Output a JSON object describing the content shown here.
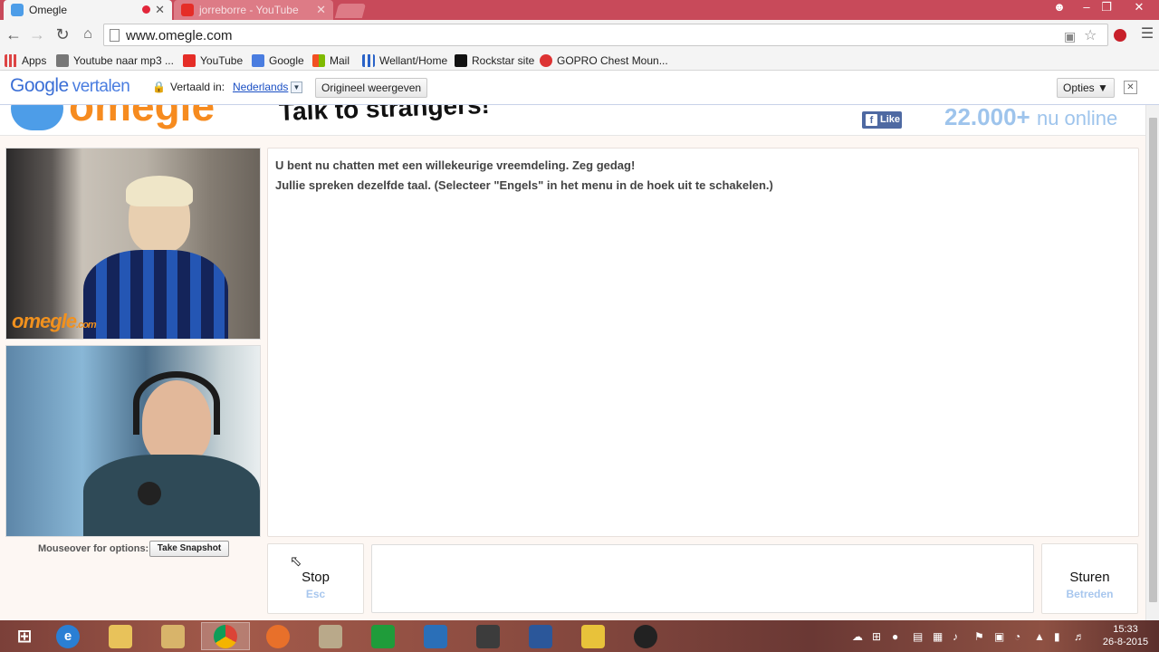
{
  "browser": {
    "tabs": [
      {
        "title": "Omegle",
        "active": true
      },
      {
        "title": "jorreborre - YouTube",
        "active": false
      }
    ],
    "url": "www.omegle.com",
    "bookmarks": [
      {
        "label": "Apps",
        "icon": "apps-grid-icon"
      },
      {
        "label": "Youtube naar mp3 ...",
        "icon": "converter-icon"
      },
      {
        "label": "YouTube",
        "icon": "youtube-icon"
      },
      {
        "label": "Google",
        "icon": "google-icon"
      },
      {
        "label": "Mail",
        "icon": "windows-mail-icon"
      },
      {
        "label": "Wellant/Home",
        "icon": "wellant-icon"
      },
      {
        "label": "Rockstar site",
        "icon": "rockstar-icon"
      },
      {
        "label": "GOPRO Chest Moun...",
        "icon": "gopro-icon"
      }
    ]
  },
  "translate_bar": {
    "logo_google": "Google",
    "logo_product": "vertalen",
    "translated_label": "Vertaald in:",
    "language": "Nederlands",
    "show_original": "Origineel weergeven",
    "options": "Opties ▼",
    "close": "✕"
  },
  "omegle": {
    "logo": "omegle",
    "tagline": "Talk to strangers!",
    "like": "Like",
    "online_count": "22.000+",
    "online_suffix": "nu online",
    "video_watermark": "omegle",
    "video_watermark_suffix": ".com",
    "mouseover_label": "Mouseover for options:",
    "snapshot_button": "Take Snapshot",
    "messages": [
      "U bent nu chatten met een willekeurige vreemdeling. Zeg gedag!",
      "Jullie spreken dezelfde taal. (Selecteer \"Engels\" in het menu in de hoek uit te schakelen.)"
    ],
    "stop_label": "Stop",
    "stop_hint": "Esc",
    "send_label": "Sturen",
    "send_hint": "Betreden",
    "message_input_value": ""
  },
  "taskbar": {
    "clock_time": "15:33",
    "clock_date": "26-8-2015"
  },
  "colors": {
    "tabstrip": "#c84a5a",
    "omegle_orange": "#f68b1f",
    "omegle_blue": "#4d9de8",
    "hint_blue": "#a8c7ee"
  }
}
